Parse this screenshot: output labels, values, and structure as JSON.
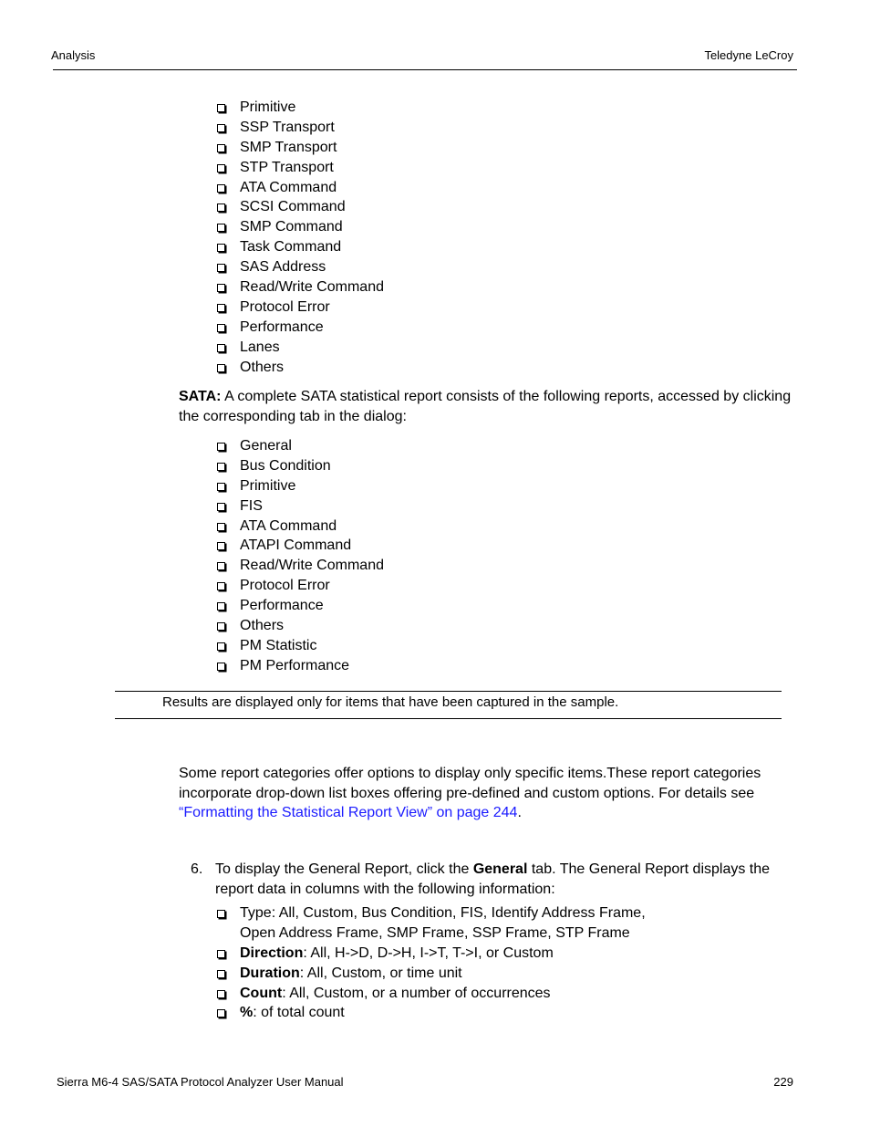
{
  "header": {
    "section": "Analysis",
    "company": "Teledyne LeCroy"
  },
  "sas_reports": [
    "Primitive",
    "SSP Transport",
    "SMP Transport",
    "STP Transport",
    "ATA Command",
    "SCSI Command",
    "SMP Command",
    "Task Command",
    "SAS Address",
    "Read/Write Command",
    "Protocol Error",
    "Performance",
    "Lanes",
    "Others"
  ],
  "sata_intro": {
    "label": "SATA:",
    "text": " A complete SATA statistical report consists of the following reports, accessed by clicking the corresponding tab in the dialog:"
  },
  "sata_reports": [
    "General",
    "Bus Condition",
    "Primitive",
    "FIS",
    "ATA Command",
    "ATAPI Command",
    "Read/Write Command",
    "Protocol Error",
    "Performance",
    "Others",
    "PM Statistic",
    "PM Performance"
  ],
  "note": "Results are displayed only for items that have been captured in the sample.",
  "options_paragraph": {
    "text": "Some report categories offer options to display only specific items.These report categories incorporate drop-down list boxes offering pre-defined and custom options. For details see ",
    "link": "“Formatting the Statistical Report View” on page 244",
    "after": "."
  },
  "step": {
    "number": "6.",
    "before": "To display the General Report, click the ",
    "bold": "General",
    "after": " tab. The General Report displays the report data in columns with the following information:"
  },
  "general_columns": [
    {
      "label": "",
      "text": "Type: All, Custom, Bus Condition, FIS, Identify Address Frame, Open Address Frame, SMP Frame, SSP Frame, STP Frame"
    },
    {
      "label": "Direction",
      "text": ": All, H->D, D->H, I->T, T->I, or Custom"
    },
    {
      "label": "Duration",
      "text": ": All, Custom, or time unit"
    },
    {
      "label": "Count",
      "text": ": All, Custom, or a number of occurrences"
    },
    {
      "label": "%",
      "text": ": of total count"
    }
  ],
  "footer": {
    "manual_title": "Sierra M6-4 SAS/SATA Protocol Analyzer User Manual",
    "page_number": "229"
  }
}
